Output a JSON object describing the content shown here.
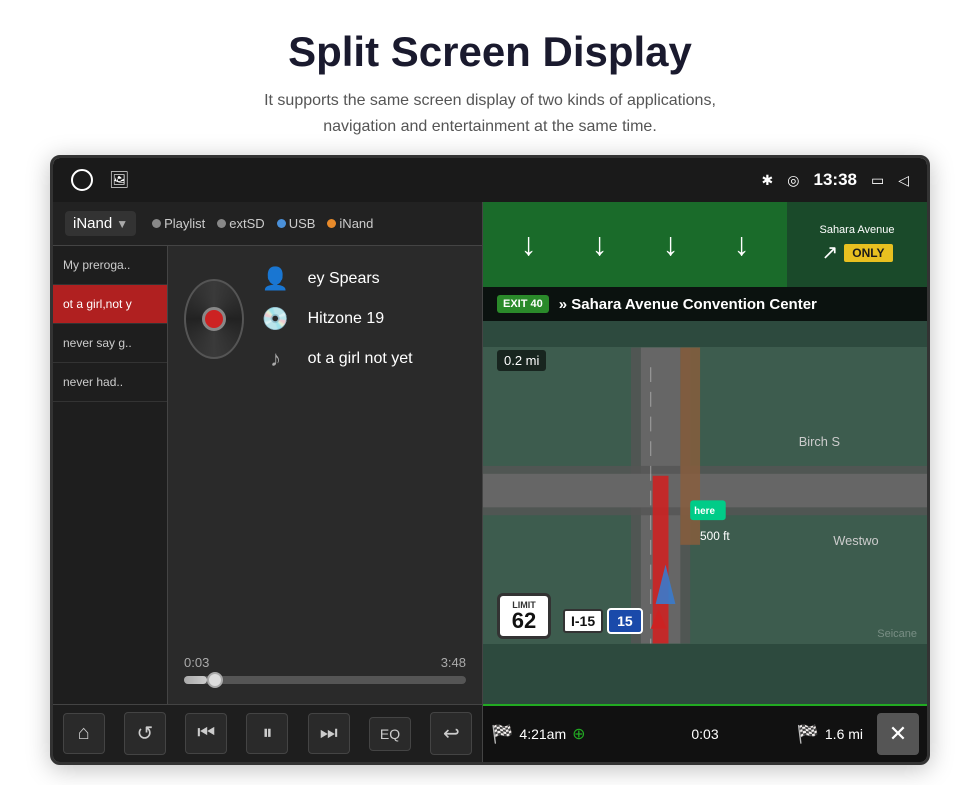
{
  "header": {
    "title": "Split Screen Display",
    "subtitle": "It supports the same screen display of two kinds of applications,\nnavigation and entertainment at the same time."
  },
  "status_bar": {
    "time": "13:38",
    "icons": [
      "bluetooth",
      "location",
      "screen",
      "back"
    ]
  },
  "media": {
    "source_label": "iNand",
    "sources": [
      "Playlist",
      "extSD",
      "USB",
      "iNand"
    ],
    "playlist_items": [
      {
        "label": "My preroga..",
        "active": false
      },
      {
        "label": "ot a girl,not y",
        "active": true
      },
      {
        "label": "never say g..",
        "active": false
      },
      {
        "label": "never had..",
        "active": false
      }
    ],
    "artist": "ey Spears",
    "album": "Hitzone 19",
    "track": "ot a girl not yet",
    "time_current": "0:03",
    "time_total": "3:48",
    "progress_percent": 8,
    "controls": {
      "home": "⌂",
      "repeat": "↺",
      "prev": "⏮",
      "pause": "⏸",
      "next": "⏭",
      "eq": "EQ",
      "back": "↩"
    }
  },
  "navigation": {
    "exit_number": "EXIT 40",
    "exit_destination": "» Sahara Avenue Convention Center",
    "top_sign": "Sahara Avenue",
    "only_label": "ONLY",
    "speed_limit": "LIMIT",
    "speed_value": "62",
    "highway_label": "I-15",
    "highway_number": "15",
    "distance_small": "0.2 mi",
    "eta_time": "4:21am",
    "eta_icon": "🏁",
    "trip_time": "0:03",
    "trip_dist": "1.6 mi",
    "close_btn": "✕"
  }
}
